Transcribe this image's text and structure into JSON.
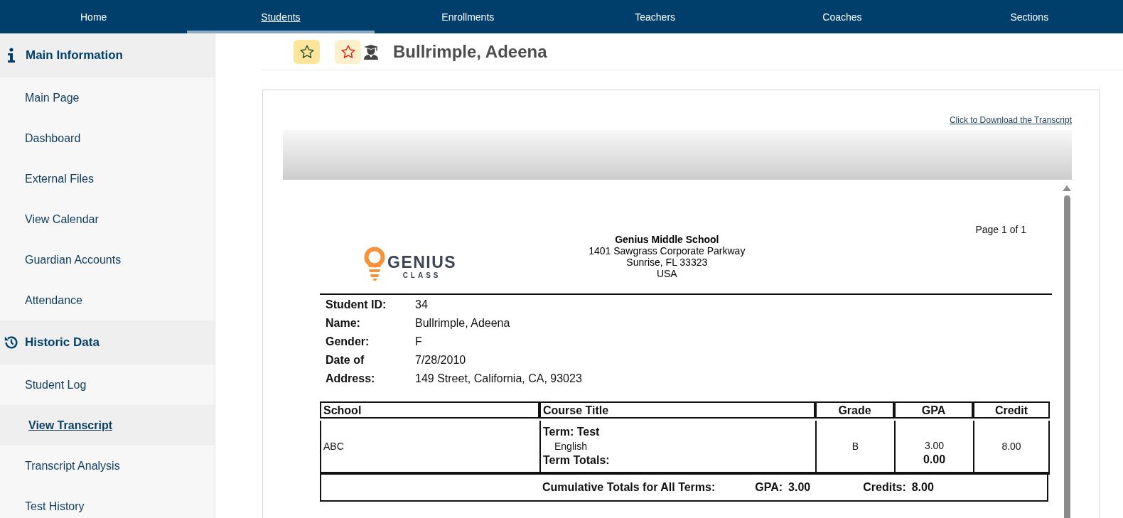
{
  "nav": [
    {
      "label": "Home",
      "selected": false
    },
    {
      "label": "Students",
      "selected": true
    },
    {
      "label": "Enrollments",
      "selected": false
    },
    {
      "label": "Teachers",
      "selected": false
    },
    {
      "label": "Coaches",
      "selected": false
    },
    {
      "label": "Sections",
      "selected": false
    }
  ],
  "sidebar": {
    "sections": [
      {
        "title": "Main Information",
        "items": [
          {
            "label": "Main Page",
            "selected": false
          },
          {
            "label": "Dashboard",
            "selected": false
          },
          {
            "label": "External Files",
            "selected": false
          },
          {
            "label": "View Calendar",
            "selected": false
          },
          {
            "label": "Guardian Accounts",
            "selected": false
          },
          {
            "label": "Attendance",
            "selected": false
          }
        ]
      },
      {
        "title": "Historic Data",
        "items": [
          {
            "label": "Student Log",
            "selected": false
          },
          {
            "label": "View Transcript",
            "selected": true
          },
          {
            "label": "Transcript Analysis",
            "selected": false
          },
          {
            "label": "Test History",
            "selected": false
          }
        ]
      }
    ]
  },
  "student_header": {
    "name": "Bullrimple, Adeena"
  },
  "transcript": {
    "download_link": "Click to Download the Transcript",
    "page": "Page 1 of 1",
    "logo": {
      "word": "GENIUS",
      "subword": "CLASS"
    },
    "school": {
      "name": "Genius Middle School",
      "address": [
        "1401 Sawgrass Corporate Parkway",
        "Sunrise, FL 33323",
        "USA"
      ]
    },
    "student_info": [
      {
        "label": "Student ID:",
        "value": "34"
      },
      {
        "label": "Name:",
        "value": "Bullrimple, Adeena"
      },
      {
        "label": "Gender:",
        "value": "F"
      },
      {
        "label": "Date of",
        "value": "7/28/2010"
      },
      {
        "label": "Address:",
        "value": "149 Street, California, CA, 93023"
      }
    ],
    "table": {
      "columns": [
        "School",
        "Course Title",
        "Grade",
        "GPA",
        "Credit"
      ],
      "rows": [
        {
          "school": "ABC",
          "term": "Term: Test",
          "course": "English",
          "grade": "B",
          "gpa": "3.00",
          "credit": "8.00",
          "term_totals_label": "Term Totals:",
          "term_totals_gpa": "0.00"
        }
      ],
      "cumulative": {
        "label": "Cumulative Totals for All Terms:",
        "gpa_label": "GPA:",
        "gpa": "3.00",
        "credits_label": "Credits:",
        "credits": "8.00"
      }
    }
  }
}
